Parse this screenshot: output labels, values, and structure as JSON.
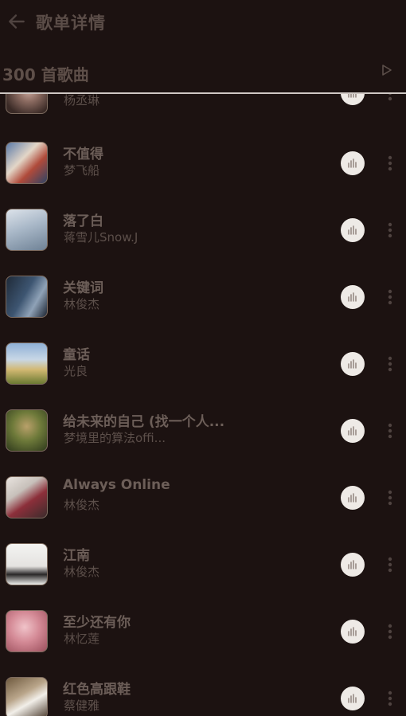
{
  "topbar": {
    "title": "歌单详情",
    "back_icon": "arrow-left-icon"
  },
  "header": {
    "count_label": "300 首歌曲",
    "play_icon": "play-outline-icon"
  },
  "colors": {
    "background": "#1c1211",
    "title_text": "#6c5e58",
    "sub_text": "#5c4f4a",
    "wave_button": "#eeeae6",
    "divider": "#cfc8c4"
  },
  "songs": [
    {
      "title": "",
      "artist": "杨丞琳"
    },
    {
      "title": "不值得",
      "artist": "梦飞船"
    },
    {
      "title": "落了白",
      "artist": "蒋雪儿Snow.J"
    },
    {
      "title": "关键词",
      "artist": "林俊杰"
    },
    {
      "title": "童话",
      "artist": "光良"
    },
    {
      "title": "给未来的自己 (找一个人...",
      "artist": "梦境里的算法offi..."
    },
    {
      "title": "Always Online",
      "artist": "林俊杰"
    },
    {
      "title": "江南",
      "artist": "林俊杰"
    },
    {
      "title": "至少还有你",
      "artist": "林忆莲"
    },
    {
      "title": "红色高跟鞋",
      "artist": "蔡健雅"
    }
  ]
}
